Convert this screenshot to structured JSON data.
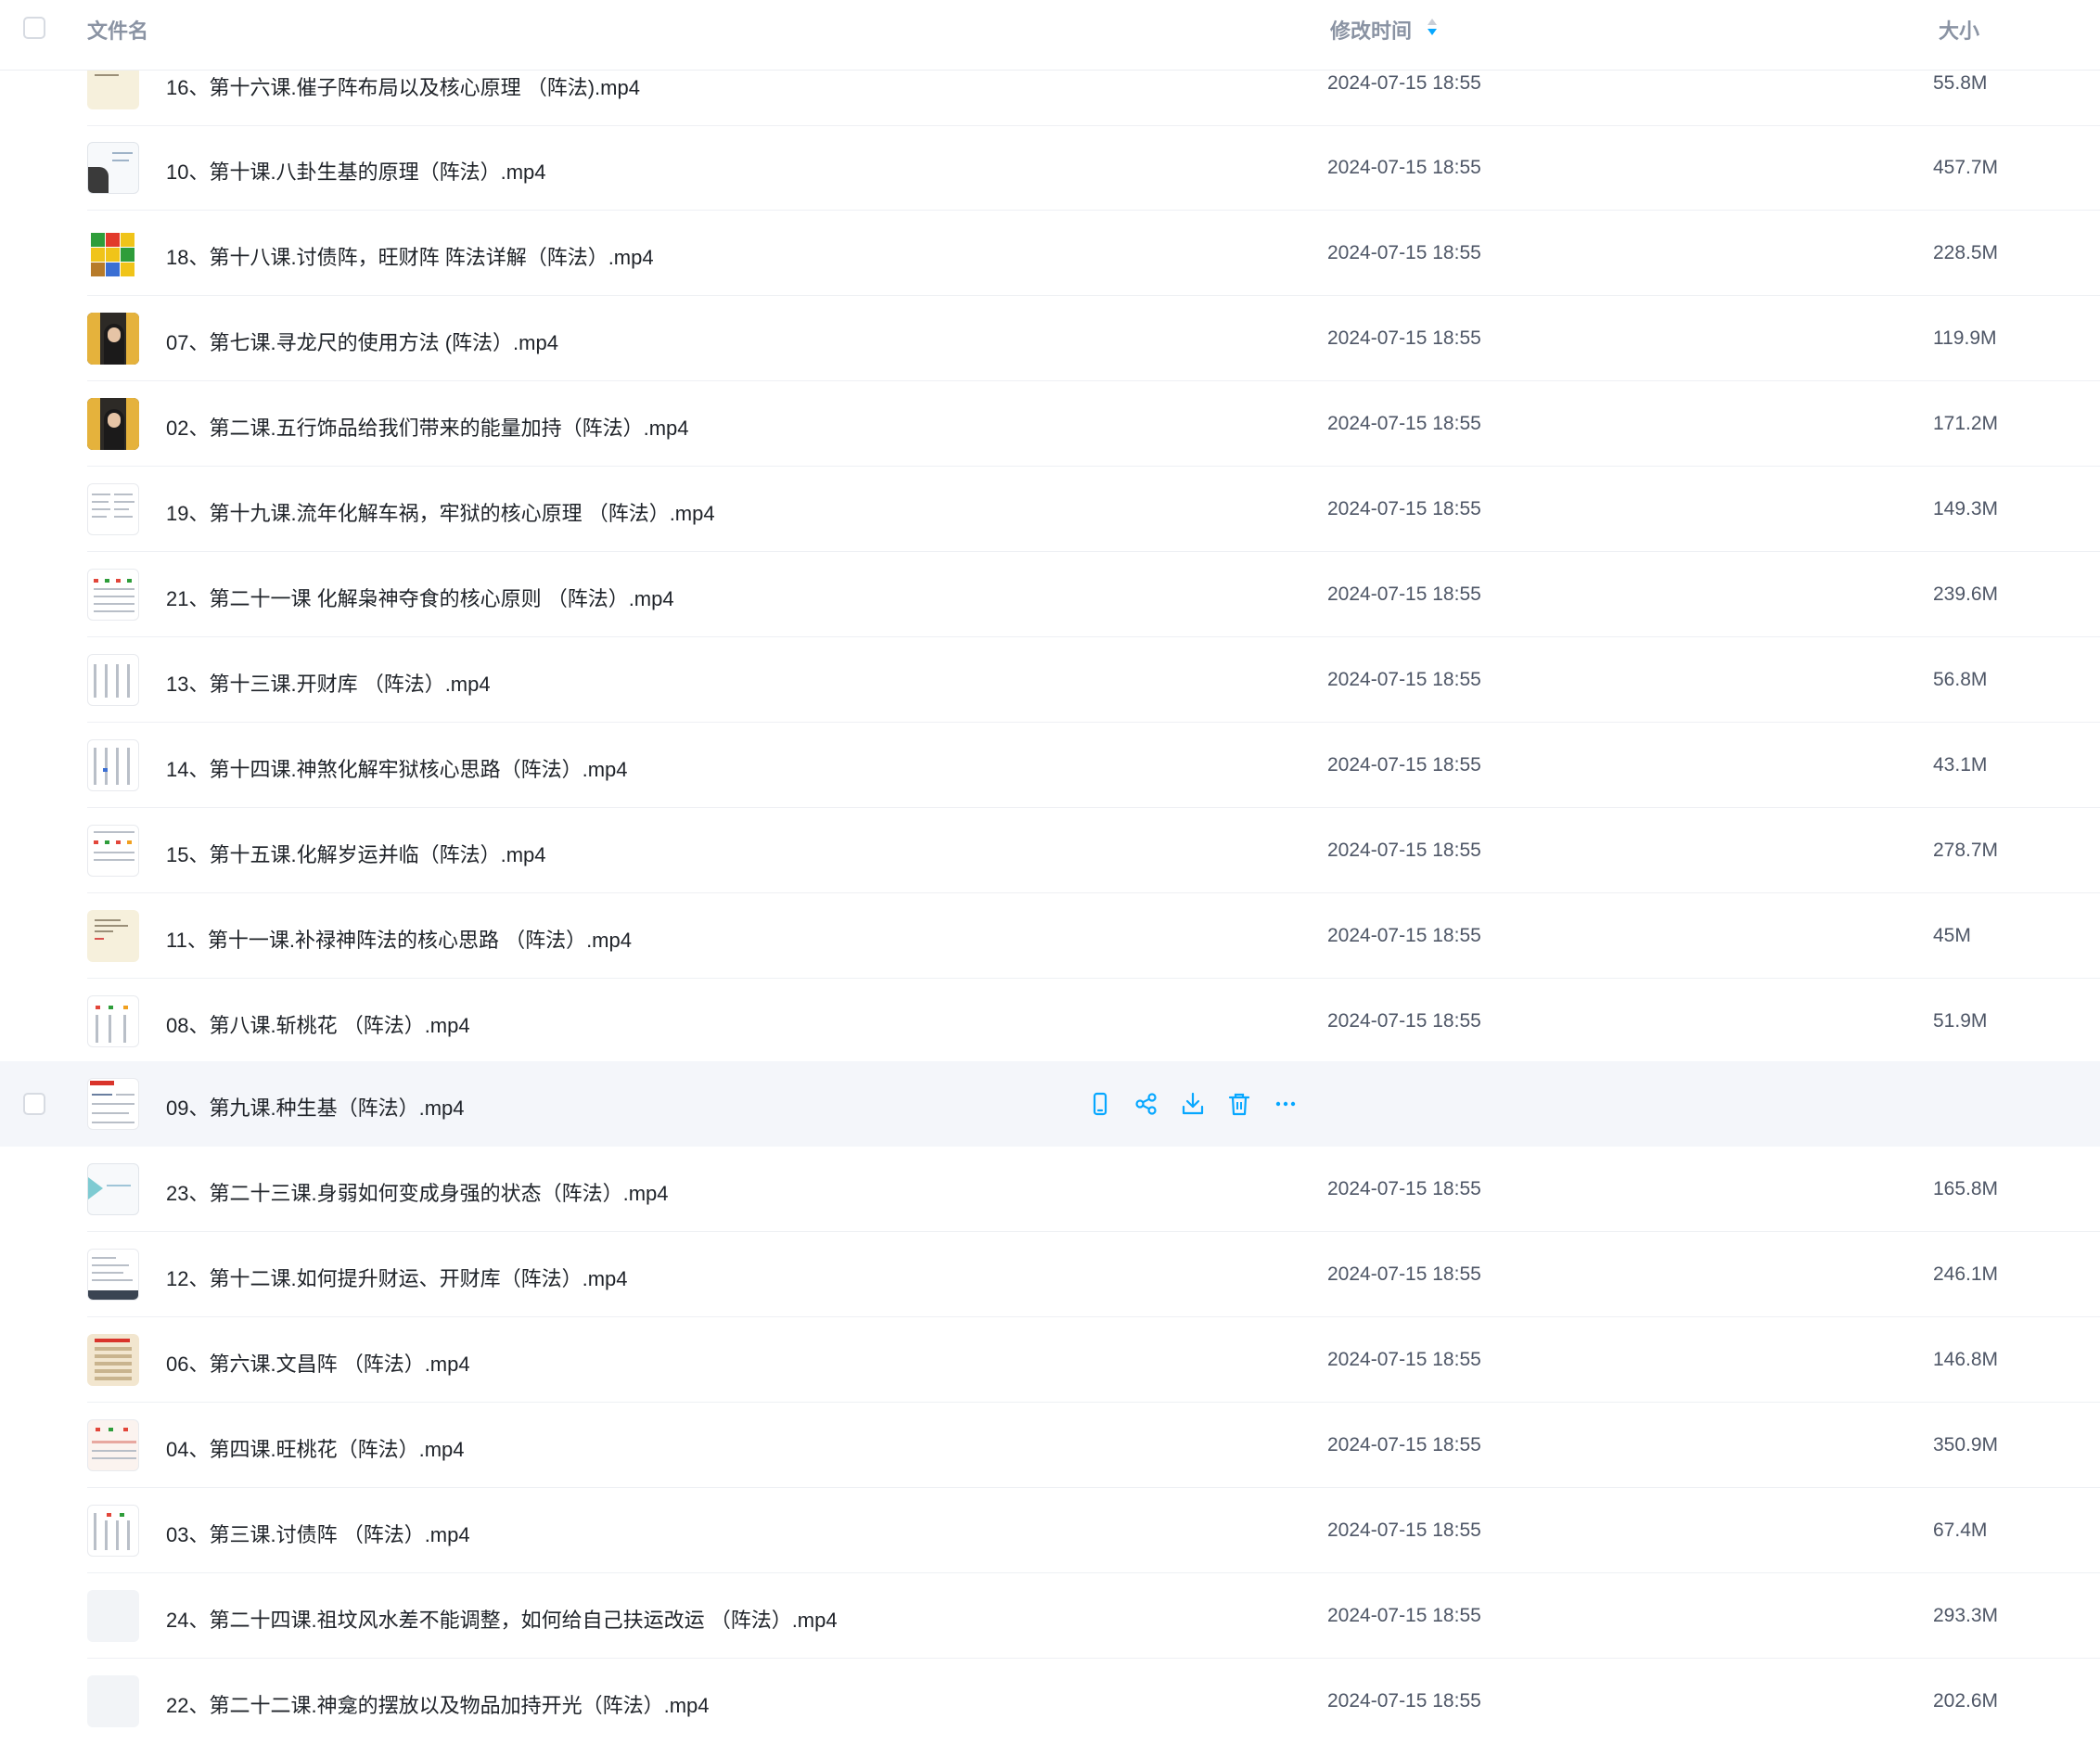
{
  "header": {
    "col_name": "文件名",
    "col_time": "修改时间",
    "col_size": "大小"
  },
  "files": [
    {
      "name": "16、第十六课.催子阵布局以及核心原理 （阵法).mp4",
      "time": "2024-07-15 18:55",
      "size": "55.8M"
    },
    {
      "name": "10、第十课.八卦生基的原理（阵法）.mp4",
      "time": "2024-07-15 18:55",
      "size": "457.7M"
    },
    {
      "name": "18、第十八课.讨债阵，旺财阵 阵法详解（阵法）.mp4",
      "time": "2024-07-15 18:55",
      "size": "228.5M"
    },
    {
      "name": "07、第七课.寻龙尺的使用方法 (阵法）.mp4",
      "time": "2024-07-15 18:55",
      "size": "119.9M"
    },
    {
      "name": "02、第二课.五行饰品给我们带来的能量加持（阵法）.mp4",
      "time": "2024-07-15 18:55",
      "size": "171.2M"
    },
    {
      "name": "19、第十九课.流年化解车祸，牢狱的核心原理 （阵法）.mp4",
      "time": "2024-07-15 18:55",
      "size": "149.3M"
    },
    {
      "name": "21、第二十一课 化解枭神夺食的核心原则 （阵法）.mp4",
      "time": "2024-07-15 18:55",
      "size": "239.6M"
    },
    {
      "name": "13、第十三课.开财库 （阵法）.mp4",
      "time": "2024-07-15 18:55",
      "size": "56.8M"
    },
    {
      "name": "14、第十四课.神煞化解牢狱核心思路（阵法）.mp4",
      "time": "2024-07-15 18:55",
      "size": "43.1M"
    },
    {
      "name": "15、第十五课.化解岁运并临（阵法）.mp4",
      "time": "2024-07-15 18:55",
      "size": "278.7M"
    },
    {
      "name": "11、第十一课.补禄神阵法的核心思路 （阵法）.mp4",
      "time": "2024-07-15 18:55",
      "size": "45M"
    },
    {
      "name": "08、第八课.斩桃花 （阵法）.mp4",
      "time": "2024-07-15 18:55",
      "size": "51.9M"
    },
    {
      "name": "09、第九课.种生基（阵法）.mp4",
      "time": "",
      "size": ""
    },
    {
      "name": "23、第二十三课.身弱如何变成身强的状态（阵法）.mp4",
      "time": "2024-07-15 18:55",
      "size": "165.8M"
    },
    {
      "name": "12、第十二课.如何提升财运、开财库（阵法）.mp4",
      "time": "2024-07-15 18:55",
      "size": "246.1M"
    },
    {
      "name": "06、第六课.文昌阵 （阵法）.mp4",
      "time": "2024-07-15 18:55",
      "size": "146.8M"
    },
    {
      "name": "04、第四课.旺桃花（阵法）.mp4",
      "time": "2024-07-15 18:55",
      "size": "350.9M"
    },
    {
      "name": "03、第三课.讨债阵 （阵法）.mp4",
      "time": "2024-07-15 18:55",
      "size": "67.4M"
    },
    {
      "name": "24、第二十四课.祖坟风水差不能调整，如何给自己扶运改运 （阵法）.mp4",
      "time": "2024-07-15 18:55",
      "size": "293.3M"
    },
    {
      "name": "22、第二十二课.神龛的摆放以及物品加持开光（阵法）.mp4",
      "time": "2024-07-15 18:55",
      "size": "202.6M"
    }
  ],
  "row_actions": [
    "phone-icon",
    "share-icon",
    "download-icon",
    "delete-icon",
    "more-icon"
  ],
  "colors": {
    "accent": "#06a7ff",
    "text": "#1f2329",
    "muted": "#4e5666",
    "hover_bg": "#f4f6fa"
  }
}
